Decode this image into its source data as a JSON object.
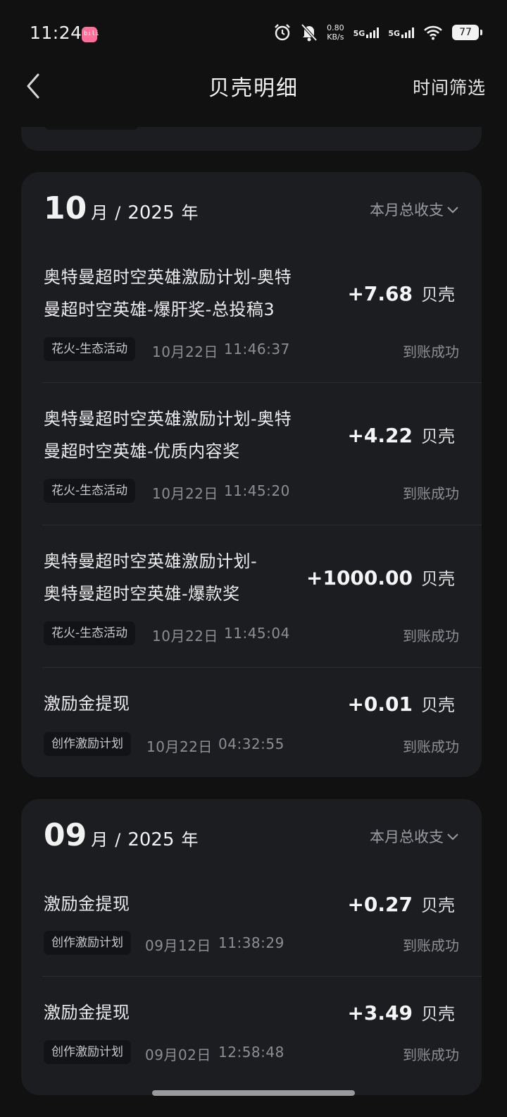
{
  "status_bar": {
    "time": "11:24",
    "app_badge": "bili",
    "speed_value": "0.80",
    "speed_unit": "KB/s",
    "network_1": "5G",
    "network_2": "5G",
    "battery": "77",
    "icons": [
      "alarm-icon",
      "mute-icon",
      "wifi-icon"
    ]
  },
  "nav": {
    "back_icon": "chevron-left-icon",
    "title": "贝壳明细",
    "filter_label": "时间筛选"
  },
  "months": [
    {
      "month": "10",
      "month_unit": "月",
      "separator": "/",
      "year": "2025",
      "year_unit": "年",
      "summary_label": "本月总收支",
      "records": [
        {
          "title": "奥特曼超时空英雄激励计划-奥特\n曼超时空英雄-爆肝奖-总投稿3",
          "amount": "+7.68",
          "unit": "贝壳",
          "tag": "花火-生态活动",
          "date": "10月22日",
          "time": "11:46:37",
          "status": "到账成功"
        },
        {
          "title": "奥特曼超时空英雄激励计划-奥特\n曼超时空英雄-优质内容奖",
          "amount": "+4.22",
          "unit": "贝壳",
          "tag": "花火-生态活动",
          "date": "10月22日",
          "time": "11:45:20",
          "status": "到账成功"
        },
        {
          "title": "奥特曼超时空英雄激励计划-\n奥特曼超时空英雄-爆款奖",
          "amount": "+1000.00",
          "unit": "贝壳",
          "tag": "花火-生态活动",
          "date": "10月22日",
          "time": "11:45:04",
          "status": "到账成功"
        },
        {
          "title": "激励金提现",
          "amount": "+0.01",
          "unit": "贝壳",
          "tag": "创作激励计划",
          "date": "10月22日",
          "time": "04:32:55",
          "status": "到账成功"
        }
      ]
    },
    {
      "month": "09",
      "month_unit": "月",
      "separator": "/",
      "year": "2025",
      "year_unit": "年",
      "summary_label": "本月总收支",
      "records": [
        {
          "title": "激励金提现",
          "amount": "+0.27",
          "unit": "贝壳",
          "tag": "创作激励计划",
          "date": "09月12日",
          "time": "11:38:29",
          "status": "到账成功"
        },
        {
          "title": "激励金提现",
          "amount": "+3.49",
          "unit": "贝壳",
          "tag": "创作激励计划",
          "date": "09月02日",
          "time": "12:58:48",
          "status": "到账成功"
        }
      ]
    }
  ],
  "colors": {
    "background": "#111112",
    "card": "#1c1d21",
    "tag_bg": "#121316",
    "muted_text": "#8d8e93"
  }
}
